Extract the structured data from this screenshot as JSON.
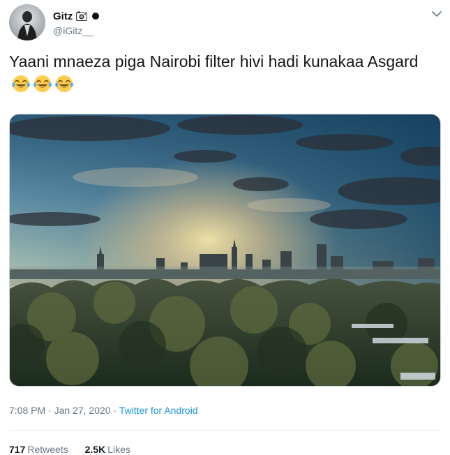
{
  "user": {
    "display_name": "Gitz",
    "handle": "@iGitz__",
    "badge_icons": [
      "camera-icon",
      "black-circle-icon"
    ]
  },
  "tweet": {
    "text": "Yaani mnaeza piga Nairobi filter hivi hadi kunakaa Asgard",
    "emoji": [
      "face-with-tears-of-joy",
      "face-with-tears-of-joy",
      "face-with-tears-of-joy"
    ]
  },
  "meta": {
    "time": "7:08 PM",
    "separator1": " · ",
    "date": "Jan 27, 2020",
    "separator2": " · ",
    "source": "Twitter for Android"
  },
  "stats": {
    "retweets_count": "717",
    "retweets_label": "Retweets",
    "likes_count": "2.5K",
    "likes_label": "Likes"
  },
  "colors": {
    "link": "#1b95e0",
    "secondary_text": "#657786",
    "primary_text": "#14171a",
    "divider": "#e6ecf0"
  }
}
